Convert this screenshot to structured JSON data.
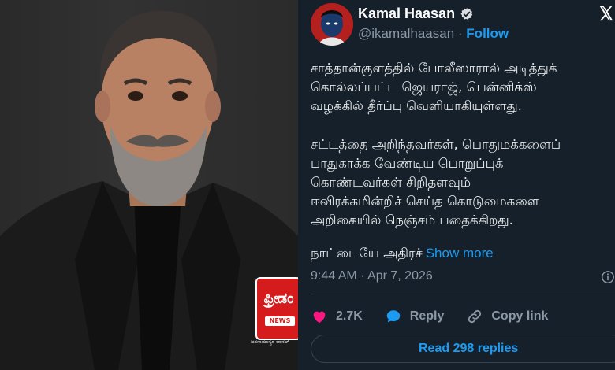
{
  "photo": {
    "description_icon": "portrait-photo"
  },
  "logo": {
    "brand": "ಫ್ರೀಡಂ",
    "tv": "TV",
    "news": "NEWS",
    "tagline": "ಜನಸಾಮಾನ್ಯರ ಚಾನಲ್"
  },
  "tweet": {
    "author_name": "Kamal Haasan",
    "handle": "@ikamalhaasan",
    "separator": "·",
    "follow_label": "Follow",
    "paragraph1": "சாத்தான்குளத்தில் போலீஸாரால் அடித்துக்\nகொல்லப்பட்ட ஜெயராஜ், பென்னிக்ஸ்\nவழக்கில் தீர்ப்பு வெளியாகியுள்ளது.",
    "paragraph2": "சட்டத்தை அறிந்தவர்கள், பொதுமக்களைப்\nபாதுகாக்க வேண்டிய பொறுப்புக்\nகொண்டவர்கள்  சிறிதளவும்\nஈவிரக்கமின்றிச் செய்த கொடுமைகளை\nஅறிகையில் நெஞ்சம் பதைக்கிறது.",
    "paragraph3": "நாட்டையே அதிரச்",
    "show_more_label": "Show more",
    "timestamp": "9:44 AM · Apr 7, 2026",
    "likes_count": "2.7K",
    "reply_label": "Reply",
    "copy_link_label": "Copy link",
    "read_replies_label": "Read 298 replies"
  },
  "colors": {
    "background": "#15202b",
    "accent": "#1d9bf0",
    "like": "#f91880",
    "muted": "#8b98a5"
  }
}
